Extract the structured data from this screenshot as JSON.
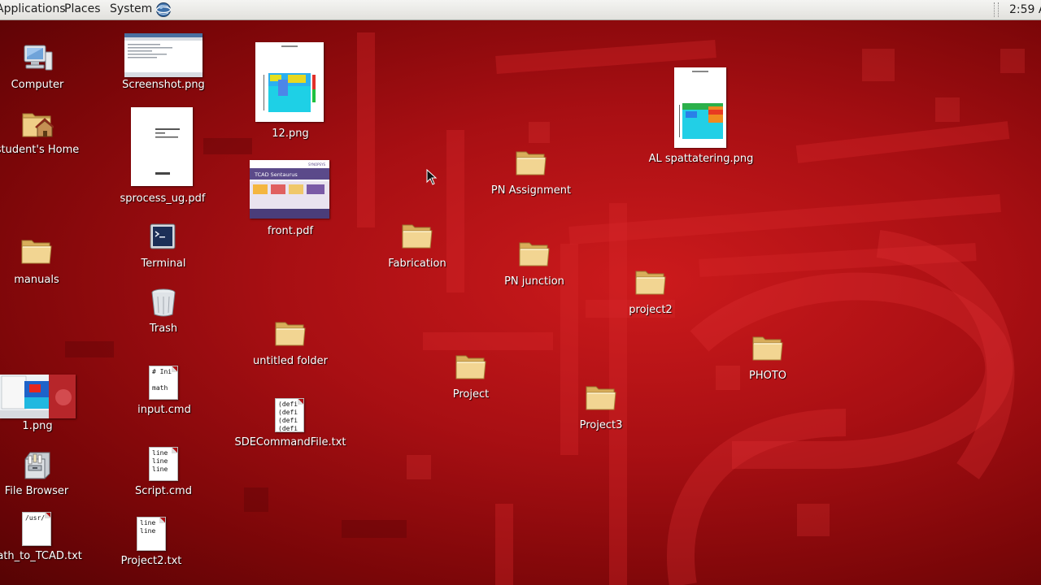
{
  "panel": {
    "applications": "Applications",
    "places": "Places",
    "system": "System",
    "clock": "2:59 A"
  },
  "icons": {
    "computer": "Computer",
    "home": "student's Home",
    "manuals": "manuals",
    "png1": "1.png",
    "file_browser": "File Browser",
    "path_to_tcad": "Path_to_TCAD.txt",
    "screenshot": "Screenshot.png",
    "sprocess": "sprocess_ug.pdf",
    "terminal": "Terminal",
    "trash": "Trash",
    "input_cmd": "input.cmd",
    "script_cmd": "Script.cmd",
    "project2_txt": "Project2.txt",
    "png12": "12.png",
    "front_pdf": "front.pdf",
    "untitled_folder": "untitled folder",
    "sde": "SDECommandFile.txt",
    "fabrication": "Fabrication",
    "project": "Project",
    "pn_assignment": "PN Assignment",
    "pn_junction": "PN junction",
    "project3": "Project3",
    "project2": "project2",
    "al_spatt": "AL spattatering.png",
    "photo": "PHOTO"
  },
  "previews": {
    "input_cmd": "# Ini\n\nmath",
    "script_cmd": "line\nline\nline",
    "project2_txt": "line\nline",
    "sde": "(defi\n(defi\n(defi\n(defi",
    "path_to_tcad": "/usr/",
    "front_pdf_title": "TCAD Sentaurus",
    "front_pdf_brand": "SYNOPSYS"
  }
}
